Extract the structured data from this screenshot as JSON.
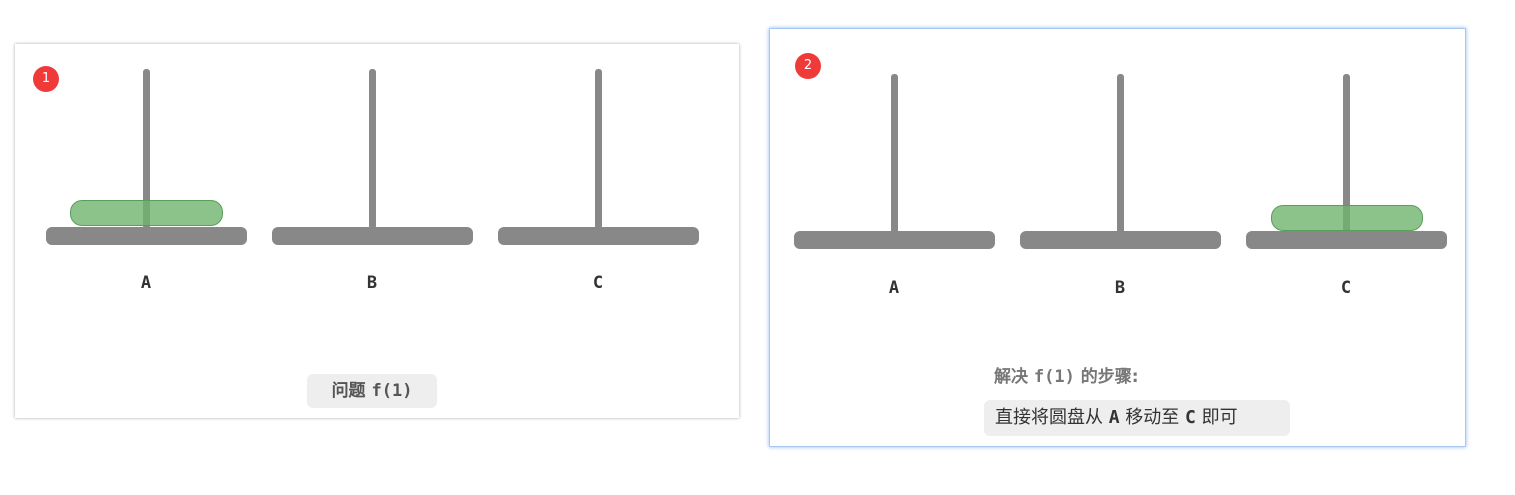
{
  "panel1": {
    "badge": "1",
    "pegs": [
      "A",
      "B",
      "C"
    ],
    "disk_on_peg": "A",
    "caption_text": "问题 ",
    "caption_code": "f(1)"
  },
  "panel2": {
    "badge": "2",
    "pegs": [
      "A",
      "B",
      "C"
    ],
    "disk_on_peg": "C",
    "steps_title_1": "解决 ",
    "steps_title_code": "f(1)",
    "steps_title_2": " 的步骤:",
    "step_text_1": "直接将圆盘从 ",
    "step_from": "A",
    "step_text_2": " 移动至 ",
    "step_to": "C",
    "step_text_3": " 即可"
  },
  "colors": {
    "rod": "#888888",
    "disk_fill": "#8cc18c",
    "disk_border": "#5a9e5a",
    "badge": "#f03a3a",
    "panel2_border": "#a8c8f0"
  }
}
